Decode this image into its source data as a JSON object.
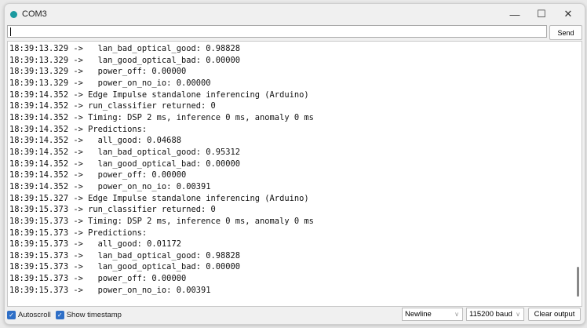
{
  "window": {
    "title": "COM3",
    "minimize": "—",
    "maximize": "☐",
    "close": "✕"
  },
  "input": {
    "value": "",
    "send_label": "Send"
  },
  "output": {
    "lines": [
      "18:39:13.329 ->   lan_bad_optical_good: 0.98828",
      "18:39:13.329 ->   lan_good_optical_bad: 0.00000",
      "18:39:13.329 ->   power_off: 0.00000",
      "18:39:13.329 ->   power_on_no_io: 0.00000",
      "18:39:14.352 -> Edge Impulse standalone inferencing (Arduino)",
      "18:39:14.352 -> run_classifier returned: 0",
      "18:39:14.352 -> Timing: DSP 2 ms, inference 0 ms, anomaly 0 ms",
      "18:39:14.352 -> Predictions:",
      "18:39:14.352 ->   all_good: 0.04688",
      "18:39:14.352 ->   lan_bad_optical_good: 0.95312",
      "18:39:14.352 ->   lan_good_optical_bad: 0.00000",
      "18:39:14.352 ->   power_off: 0.00000",
      "18:39:14.352 ->   power_on_no_io: 0.00391",
      "18:39:15.327 -> Edge Impulse standalone inferencing (Arduino)",
      "18:39:15.373 -> run_classifier returned: 0",
      "18:39:15.373 -> Timing: DSP 2 ms, inference 0 ms, anomaly 0 ms",
      "18:39:15.373 -> Predictions:",
      "18:39:15.373 ->   all_good: 0.01172",
      "18:39:15.373 ->   lan_bad_optical_good: 0.98828",
      "18:39:15.373 ->   lan_good_optical_bad: 0.00000",
      "18:39:15.373 ->   power_off: 0.00000",
      "18:39:15.373 ->   power_on_no_io: 0.00391"
    ]
  },
  "footer": {
    "autoscroll": "Autoscroll",
    "show_timestamp": "Show timestamp",
    "line_ending": "Newline",
    "baud": "115200 baud",
    "clear": "Clear output"
  }
}
